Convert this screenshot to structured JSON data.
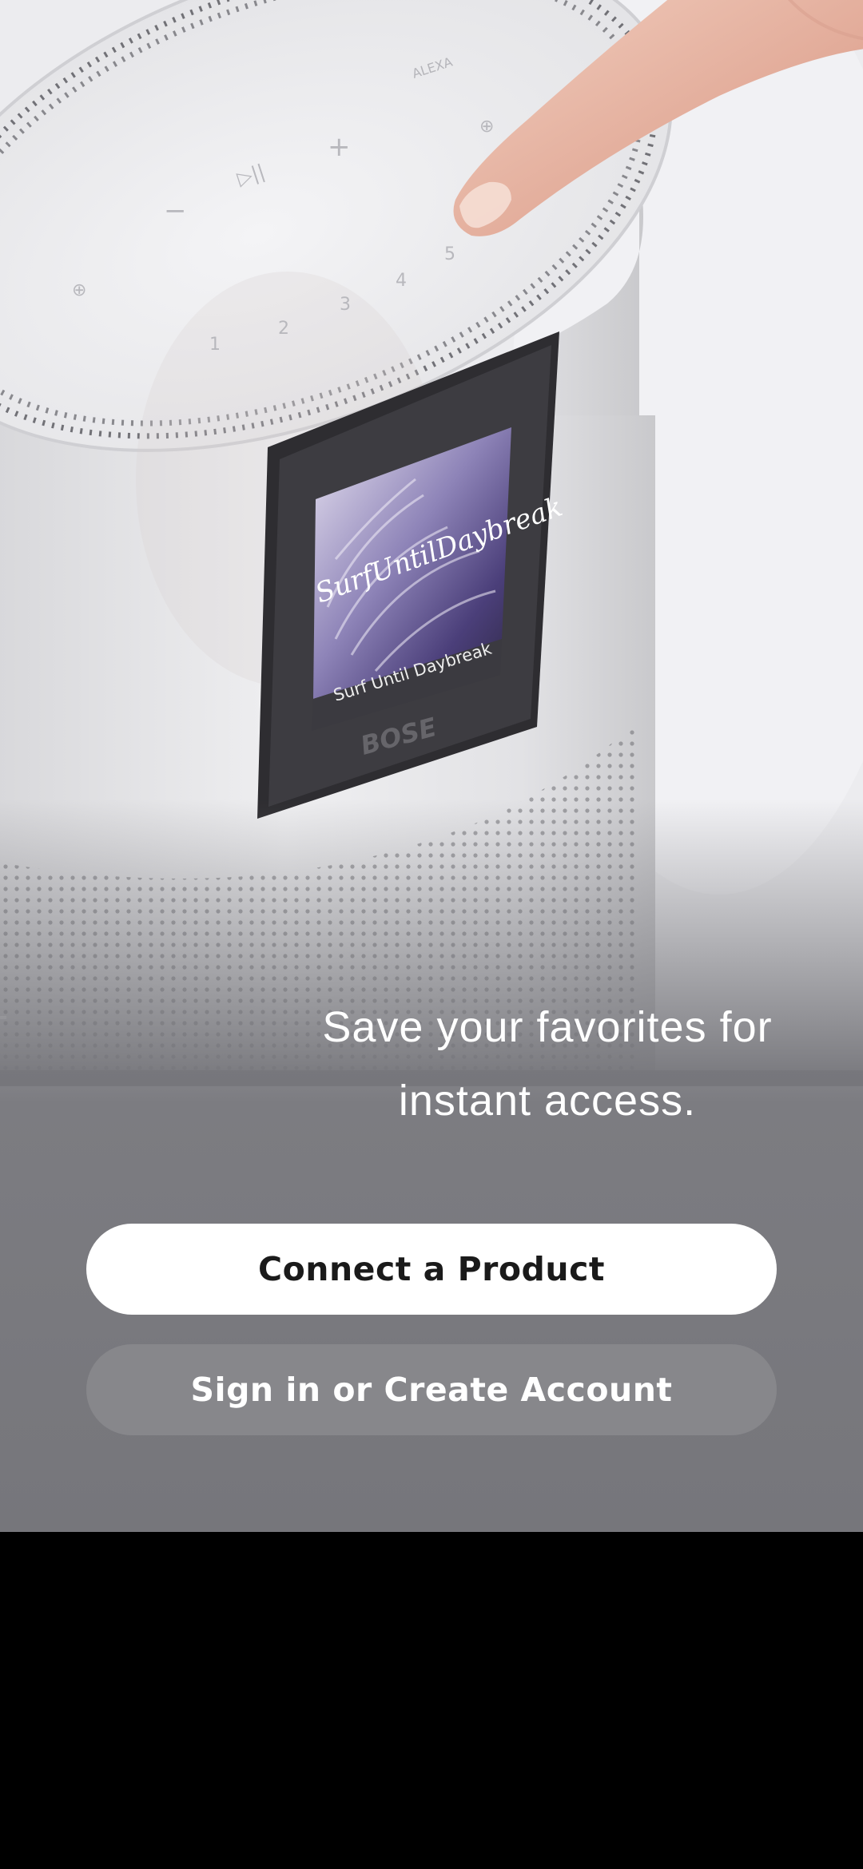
{
  "hero": {
    "now_playing_title": "Surf Until Daybreak",
    "album_art_script": "SurfUntilDaybreak",
    "speaker_controls": [
      "ALEXA",
      "+",
      "▷||",
      "−",
      "1",
      "2",
      "3",
      "4",
      "5"
    ],
    "brand": "BOSE"
  },
  "onboarding": {
    "tagline_line1": "Save your favorites for",
    "tagline_line2": "instant access.",
    "connect_label": "Connect a Product",
    "signin_label": "Sign in or Create Account"
  },
  "colors": {
    "background": "#76767b",
    "primary_button": "#ffffff",
    "secondary_button": "#87878b"
  }
}
